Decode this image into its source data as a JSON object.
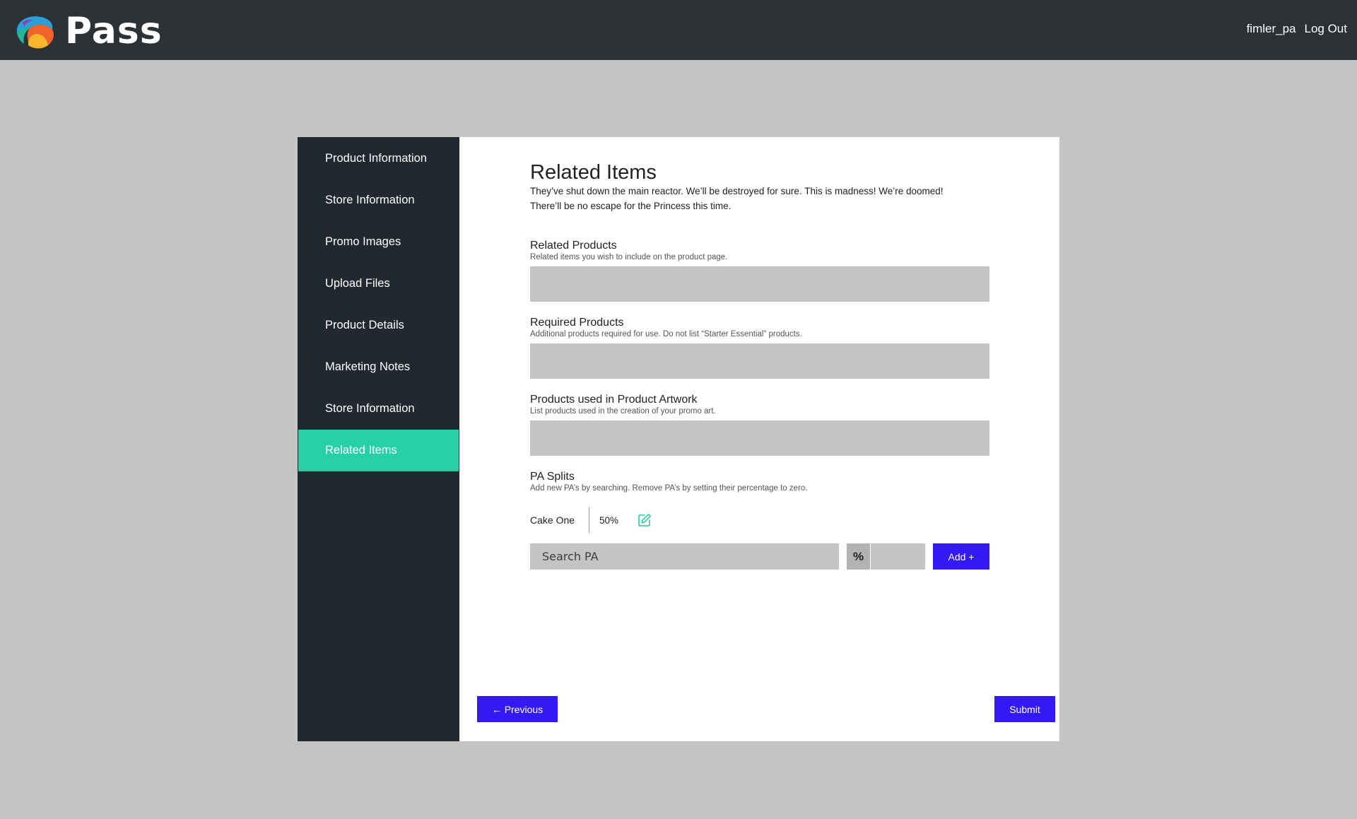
{
  "header": {
    "app_name": "Pass",
    "username": "fimler_pa",
    "logout_label": "Log Out"
  },
  "sidebar": {
    "items": [
      {
        "label": "Product Information"
      },
      {
        "label": "Store Information"
      },
      {
        "label": "Promo Images"
      },
      {
        "label": "Upload Files"
      },
      {
        "label": "Product Details"
      },
      {
        "label": "Marketing Notes"
      },
      {
        "label": "Store Information"
      },
      {
        "label": "Related Items",
        "active": true
      }
    ]
  },
  "main": {
    "title": "Related Items",
    "intro_line1": "They’ve shut down the main reactor. We’ll be destroyed for sure. This is madness! We’re doomed!",
    "intro_line2": "There’ll be no escape for the Princess this time.",
    "related_products": {
      "label": "Related Products",
      "help": "Related items you wish to include on the product page.",
      "value": ""
    },
    "required_products": {
      "label": "Required Products",
      "help": "Additional products required for use. Do not list “Starter Essential” products.",
      "value": ""
    },
    "artwork_products": {
      "label": "Products used in Product Artwork",
      "help": "List products used in the creation of your promo art.",
      "value": ""
    },
    "pa_splits": {
      "label": "PA Splits",
      "help": "Add new PA’s by searching. Remove PA’s by setting their percentage to zero.",
      "entries": [
        {
          "name": "Cake One",
          "percent": "50%"
        }
      ],
      "search_placeholder": "Search PA",
      "percent_symbol": "%",
      "add_label": "Add +"
    }
  },
  "footer": {
    "previous_label": "← Previous",
    "submit_label": "Submit"
  },
  "colors": {
    "topbar": "#2c3136",
    "sidebar": "#22282f",
    "active_nav": "#26d0a6",
    "button": "#3219f5",
    "background": "#c4c4c4",
    "edit_icon": "#26c99e"
  }
}
